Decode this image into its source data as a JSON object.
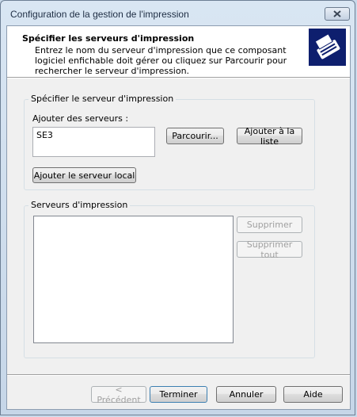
{
  "window": {
    "title": "Configuration de la gestion de l'impression"
  },
  "header": {
    "title": "Spécifier les serveurs d'impression",
    "description": "Entrez le nom du serveur d'impression que ce composant logiciel enfichable doit gérer ou cliquez sur Parcourir pour rechercher le serveur d'impression.",
    "icon": "printer-icon"
  },
  "specify_group": {
    "label": "Spécifier le serveur d'impression",
    "add_servers_label": "Ajouter des serveurs :",
    "server_input_value": "SE3",
    "browse_button": "Parcourir...",
    "add_to_list_button": "Ajouter à la liste",
    "add_local_button": "Ajouter le serveur local"
  },
  "servers_group": {
    "label": "Serveurs d'impression",
    "items": [],
    "remove_button": "Supprimer",
    "remove_all_button": "Supprimer tout"
  },
  "footer": {
    "previous_button": "< Précédent",
    "finish_button": "Terminer",
    "cancel_button": "Annuler",
    "help_button": "Aide"
  },
  "colors": {
    "icon_background": "#0e1f6e",
    "dialog_background": "#f0f0f0"
  }
}
